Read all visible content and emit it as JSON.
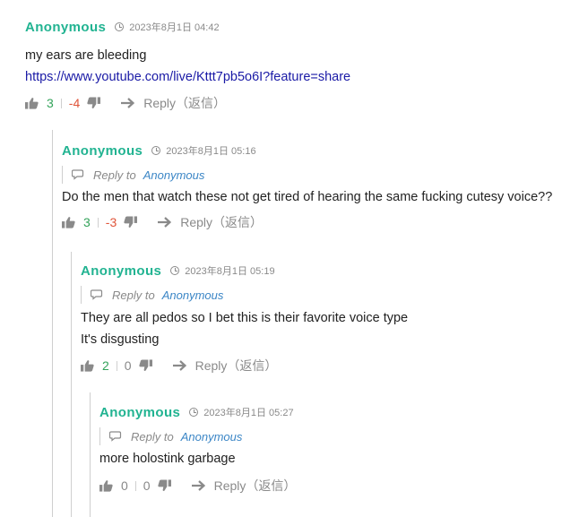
{
  "comments": [
    {
      "author": "Anonymous",
      "time": "2023年8月1日 04:42",
      "lines": [
        "my ears are bleeding"
      ],
      "link": "https://www.youtube.com/live/Kttt7pb5o6I?feature=share",
      "upvotes": "3",
      "downvotes": "-4",
      "reply_label": "Reply（返信）"
    },
    {
      "author": "Anonymous",
      "time": "2023年8月1日 05:16",
      "reply_to_label": "Reply to",
      "reply_to_name": "Anonymous",
      "lines": [
        "Do the men that watch these not get tired of hearing the same fucking cutesy voice??"
      ],
      "upvotes": "3",
      "downvotes": "-3",
      "reply_label": "Reply（返信）"
    },
    {
      "author": "Anonymous",
      "time": "2023年8月1日 05:19",
      "reply_to_label": "Reply to",
      "reply_to_name": "Anonymous",
      "lines": [
        "They are all pedos so I bet this is their favorite voice type",
        "It's disgusting"
      ],
      "upvotes": "2",
      "downvotes": "0",
      "reply_label": "Reply（返信）"
    },
    {
      "author": "Anonymous",
      "time": "2023年8月1日 05:27",
      "reply_to_label": "Reply to",
      "reply_to_name": "Anonymous",
      "lines": [
        "more holostink garbage"
      ],
      "upvotes": "0",
      "downvotes": "0",
      "reply_label": "Reply（返信）"
    }
  ],
  "colors": {
    "author": "#21b391",
    "upvote": "#33a35a",
    "downvote": "#e0553a",
    "link": "#1a1aa6",
    "reply_to_name": "#3b86c6"
  },
  "icons": [
    "clock-icon",
    "speech-bubble-icon",
    "thumbs-up-icon",
    "thumbs-down-icon",
    "reply-arrow-icon"
  ]
}
